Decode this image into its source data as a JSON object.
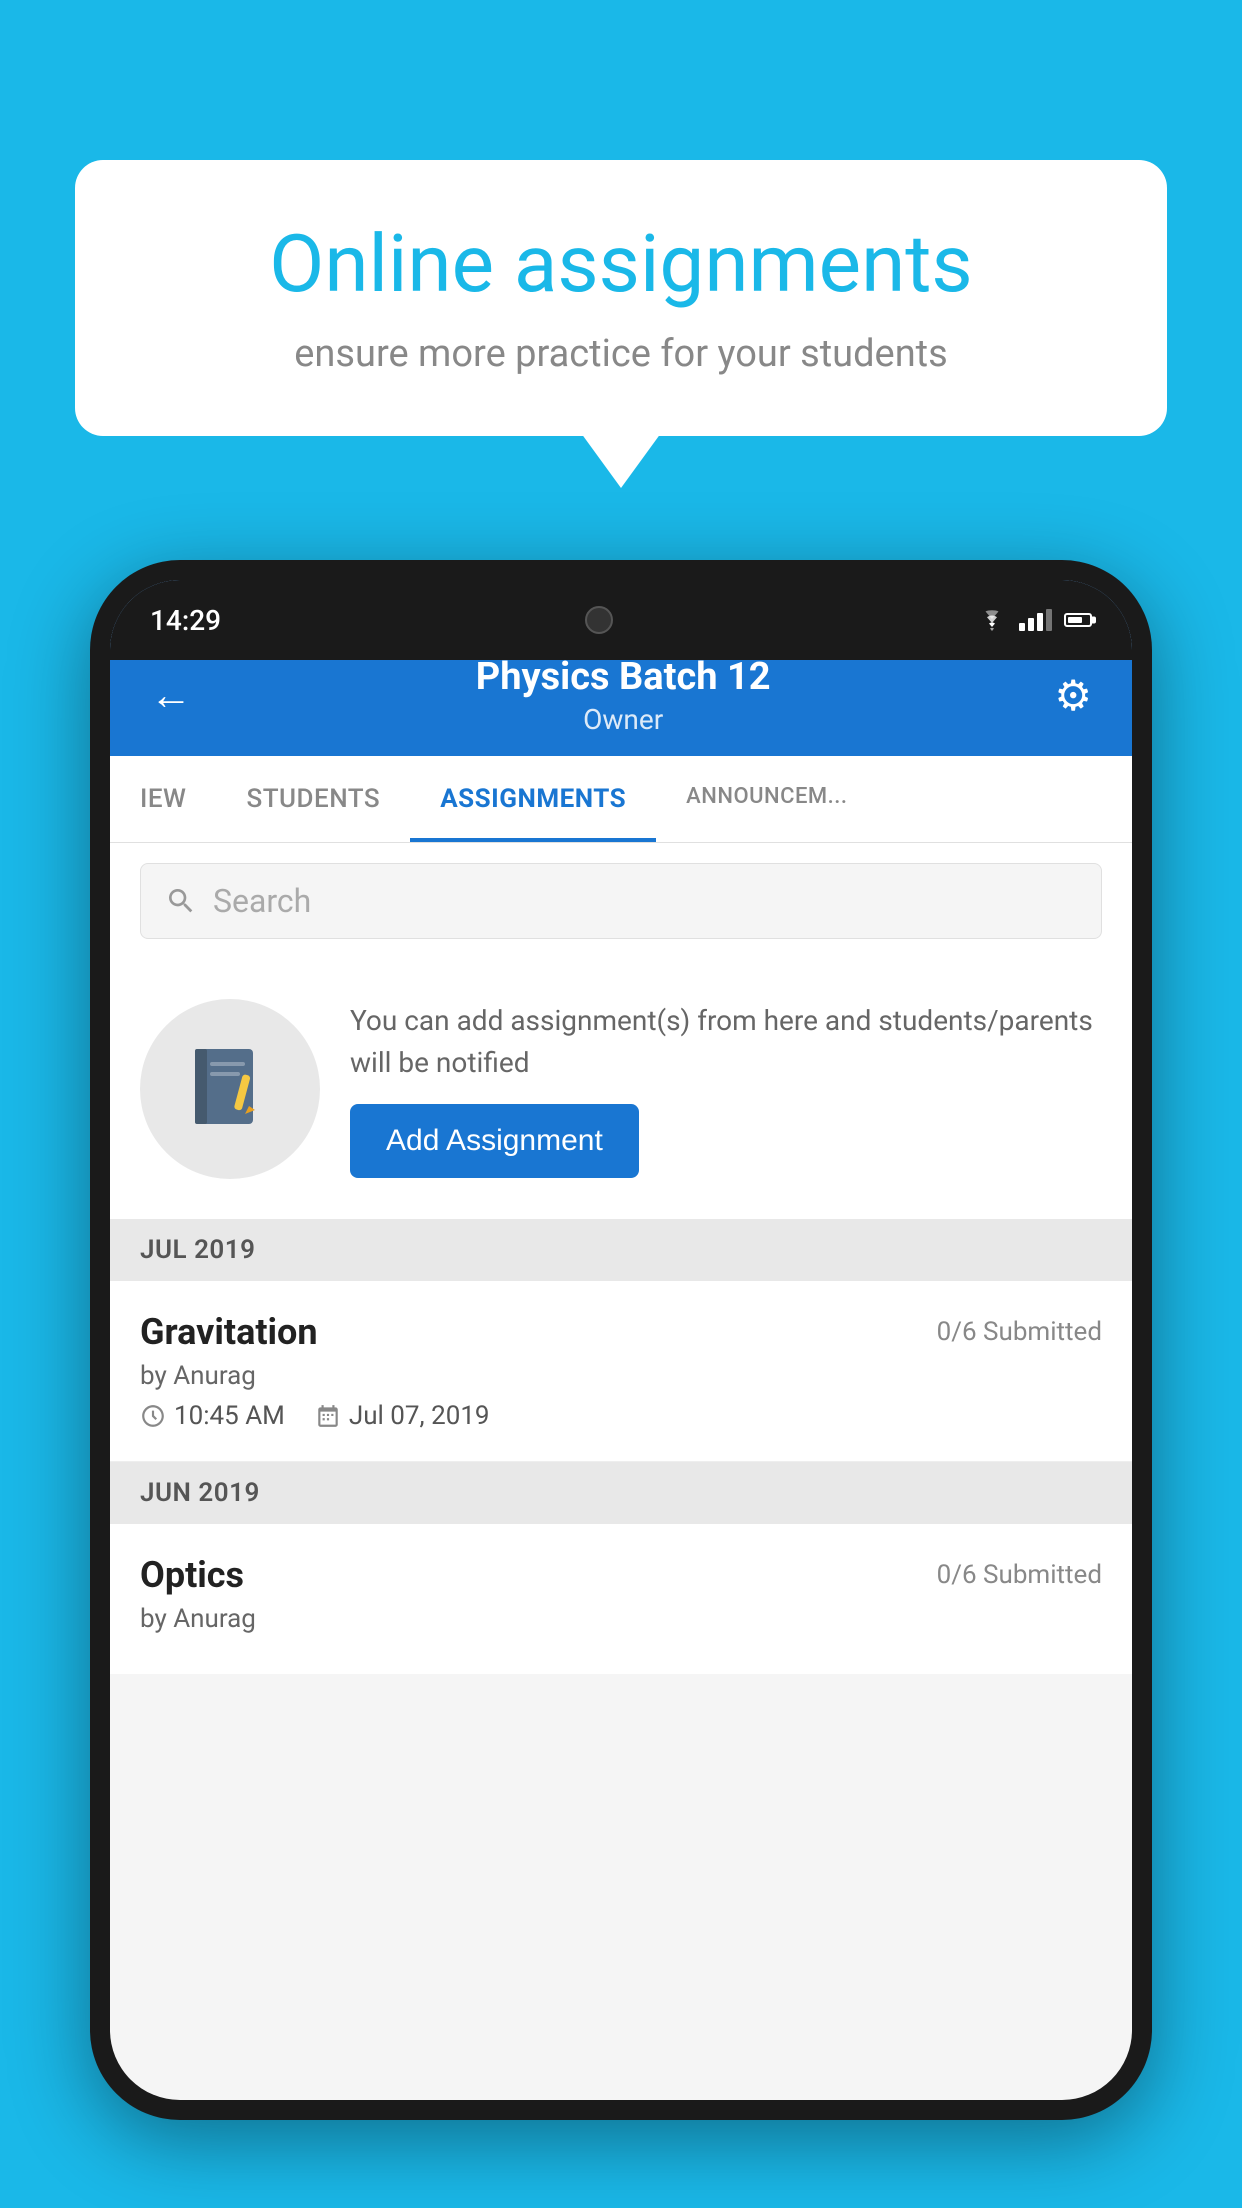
{
  "background_color": "#1ab8e8",
  "speech_bubble": {
    "title": "Online assignments",
    "subtitle": "ensure more practice for your students"
  },
  "phone": {
    "status_bar": {
      "time": "14:29"
    },
    "header": {
      "title": "Physics Batch 12",
      "subtitle": "Owner",
      "back_label": "←",
      "gear_label": "⚙"
    },
    "tabs": [
      {
        "label": "IEW",
        "active": false
      },
      {
        "label": "STUDENTS",
        "active": false
      },
      {
        "label": "ASSIGNMENTS",
        "active": true
      },
      {
        "label": "ANNOUNCEM...",
        "active": false
      }
    ],
    "search": {
      "placeholder": "Search"
    },
    "promo": {
      "text": "You can add assignment(s) from here and students/parents will be notified",
      "button_label": "Add Assignment"
    },
    "sections": [
      {
        "header": "JUL 2019",
        "assignments": [
          {
            "name": "Gravitation",
            "submitted": "0/6 Submitted",
            "by": "by Anurag",
            "time": "10:45 AM",
            "date": "Jul 07, 2019"
          }
        ]
      },
      {
        "header": "JUN 2019",
        "assignments": [
          {
            "name": "Optics",
            "submitted": "0/6 Submitted",
            "by": "by Anurag",
            "time": "",
            "date": ""
          }
        ]
      }
    ]
  }
}
